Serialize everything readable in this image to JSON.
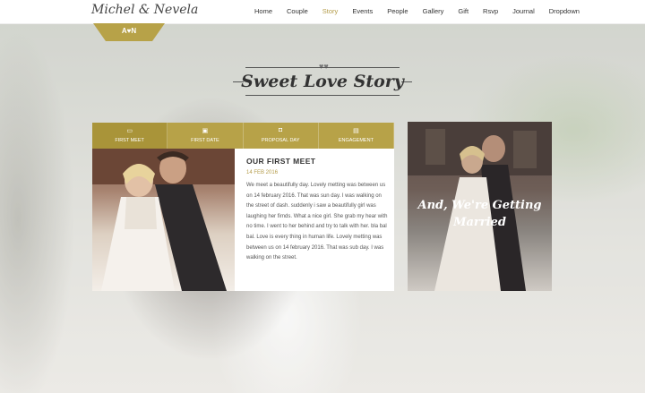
{
  "header": {
    "logo": "Michel & Nevela",
    "nav": [
      "Home",
      "Couple",
      "Story",
      "Events",
      "People",
      "Gallery",
      "Gift",
      "Rsvp",
      "Journal",
      "Dropdown"
    ],
    "active": "Story"
  },
  "badge": {
    "text": "A♥N"
  },
  "section": {
    "title": "Sweet Love Story"
  },
  "tabs": [
    {
      "label": "FIRST MEET",
      "icon": "ticket-icon"
    },
    {
      "label": "FIRST DATE",
      "icon": "calendar-icon"
    },
    {
      "label": "PROPOSAL DAY",
      "icon": "ring-box-icon"
    },
    {
      "label": "ENGAGEMENT",
      "icon": "photo-icon"
    }
  ],
  "story": {
    "heading": "OUR FIRST MEET",
    "date": "14 FEB 2016",
    "body": "We meet a beautifully day. Lovely metting was between us on 14 february 2016. That was sun day. I was walking on the street of dash. suddenly i saw a beautifully girl was laughing her firnds. What a nice girl. She grab my hear with no time. I went to her behind and try to talk with her. bla bal bal. Love is every thing in human life. Lovely metting was between us on 14 february 2016. That was sub day. I was walking on the street."
  },
  "side": {
    "line1": "And, We're Getting",
    "line2": "Married"
  },
  "colors": {
    "accent": "#b7a248",
    "accent_text": "#b49c4a"
  }
}
